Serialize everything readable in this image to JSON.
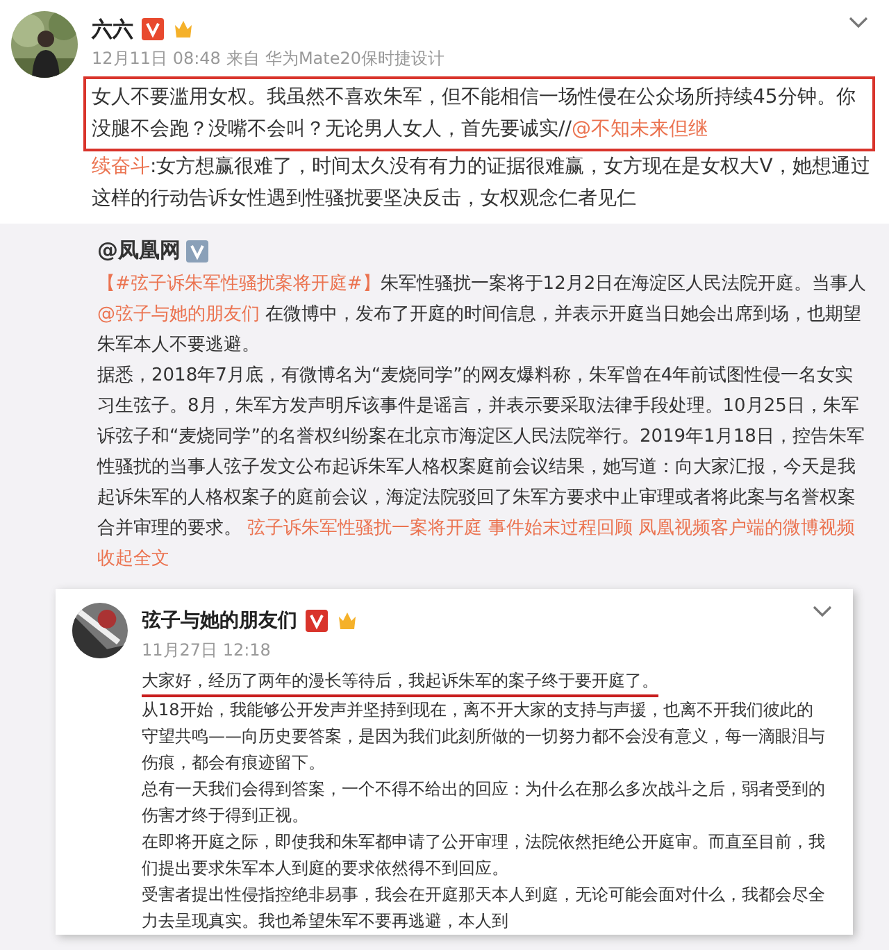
{
  "post": {
    "author": "六六",
    "time": "12月11日 08:48",
    "source_prefix": "来自",
    "source": "华为Mate20保时捷设计",
    "highlighted_text": "女人不要滥用女权。我虽然不喜欢朱军，但不能相信一场性侵在公众场所持续45分钟。你没腿不会跑？没嘴不会叫？无论男人女人，首先要诚实//",
    "highlighted_mention": "@不知未来但继",
    "mention_rest": "续奋斗",
    "text_rest": ":女方想赢很难了，时间太久没有有力的证据很难赢，女方现在是女权大V，她想通过这样的行动告诉女性遇到性骚扰要坚决反击，女权观念仁者见仁"
  },
  "retweet": {
    "author": "@凤凰网",
    "paragraphs": [
      {
        "hashtag": "【#弦子诉朱军性骚扰案将开庭#】",
        "before": "朱军性骚扰一案将于12月2日在海淀区人民法院开庭。当事人",
        "mention": "@弦子与她的朋友们",
        "after": " 在微博中，发布了开庭的时间信息，并表示开庭当日她会出席到场，也期望朱军本人不要逃避。"
      },
      {
        "text": "据悉，2018年7月底，有微博名为“麦烧同学”的网友爆料称，朱军曾在4年前试图性侵一名女实习生弦子。8月，朱军方发声明斥该事件是谣言，并表示要采取法律手段处理。10月25日，朱军诉弦子和“麦烧同学”的名誉权纠纷案在北京市海淀区人民法院举行。2019年1月18日，控告朱军性骚扰的当事人弦子发文公布起诉朱军人格权案庭前会议结果，她写道：向大家汇报，今天是我起诉朱军的人格权案子的庭前会议，海淀法院驳回了朱军方要求中止审理或者将此案与名誉权案合并审理的要求。",
        "links": [
          "弦子诉朱军性骚扰一案将开庭 事件始末过程回顾",
          "凤凰视频客户端的微博视频"
        ],
        "collapse": "收起全文"
      }
    ]
  },
  "embedded": {
    "author": "弦子与她的朋友们",
    "time": "11月27日 12:18",
    "underlined": "大家好，经历了两年的漫长等待后，我起诉朱军的案子终于要开庭了。",
    "paragraphs": [
      "从18开始，我能够公开发声并坚持到现在，离不开大家的支持与声援，也离不开我们彼此的守望共鸣——向历史要答案，是因为我们此刻所做的一切努力都不会没有意义，每一滴眼泪与伤痕，都会有痕迹留下。",
      "总有一天我们会得到答案，一个不得不给出的回应：为什么在那么多次战斗之后，弱者受到的伤害才终于得到正视。",
      "在即将开庭之际，即使我和朱军都申请了公开审理，法院依然拒绝公开庭审。而直至目前，我们提出要求朱军本人到庭的要求依然得不到回应。",
      "受害者提出性侵指控绝非易事，我会在开庭那天本人到庭，无论可能会面对什么，我都会尽全力去呈现真实。我也希望朱军不要再逃避，本人到"
    ]
  }
}
